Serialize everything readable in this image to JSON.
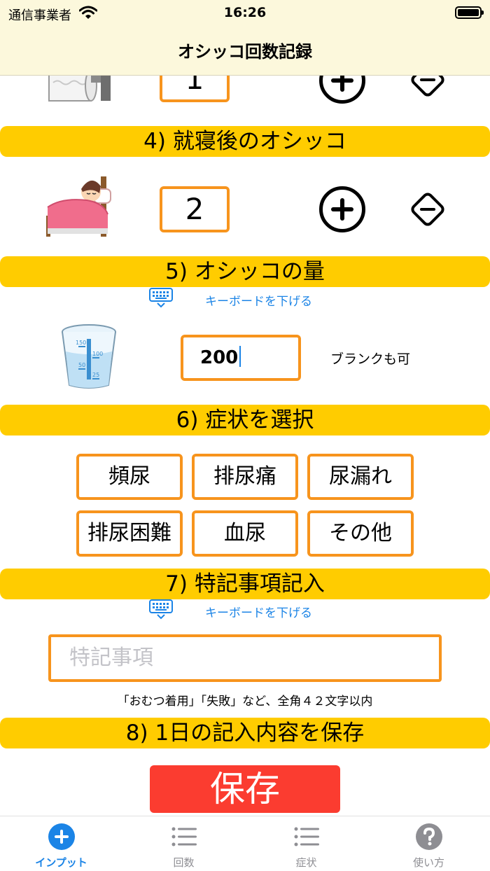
{
  "status_bar": {
    "carrier": "通信事業者",
    "time": "16:26"
  },
  "nav": {
    "title": "オシッコ回数記録"
  },
  "counter_prev": {
    "value": "1"
  },
  "section4": {
    "title": "4) 就寝後のオシッコ",
    "count": "2"
  },
  "section5": {
    "title": "5) オシッコの量",
    "keyboard_label": "キーボードを下げる",
    "amount_value": "200",
    "blank_note": "ブランクも可"
  },
  "section6": {
    "title": "6) 症状を選択",
    "symptoms": [
      "頻尿",
      "排尿痛",
      "尿漏れ",
      "排尿困難",
      "血尿",
      "その他"
    ]
  },
  "section7": {
    "title": "7) 特記事項記入",
    "keyboard_label": "キーボードを下げる",
    "note_placeholder": "特記事項",
    "note_hint": "「おむつ着用」「失敗」など、全角４２文字以内"
  },
  "section8": {
    "title": "8) 1日の記入内容を保存",
    "save_label": "保存"
  },
  "tabs": [
    {
      "label": "インプット",
      "icon": "plus-circle-icon",
      "active": true
    },
    {
      "label": "回数",
      "icon": "list-icon",
      "active": false
    },
    {
      "label": "症状",
      "icon": "list-icon",
      "active": false
    },
    {
      "label": "使い方",
      "icon": "question-circle-icon",
      "active": false
    }
  ],
  "colors": {
    "section_bar": "#ffcc00",
    "border": "#f7941d",
    "save": "#fb3c30",
    "link": "#1b84e6",
    "nav_bg": "#fcf8dc"
  }
}
